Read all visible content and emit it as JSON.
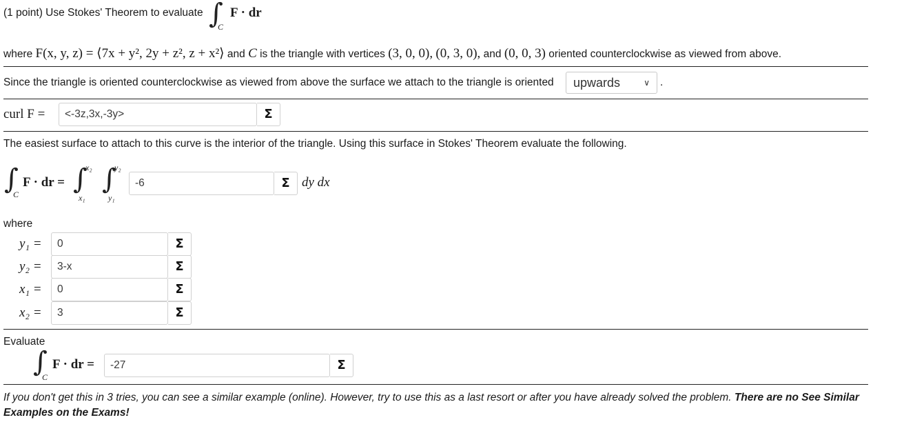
{
  "header": {
    "intro": "(1 point) Use Stokes' Theorem to evaluate",
    "integral_sub": "C",
    "integrand": "F · dr"
  },
  "problem": {
    "where_word": "where",
    "field_expr": "F(x, y, z) = ⟨7x + y², 2y + z², z + x²⟩",
    "and_c": "and",
    "c_symbol": "C",
    "triangle_text": "is the triangle with vertices",
    "v1": "(3, 0, 0),",
    "v2": "(0, 3, 0),",
    "and_word": "and",
    "v3": "(0, 0, 3)",
    "orient_text": "oriented counterclockwise as viewed from above."
  },
  "orientation": {
    "text": "Since the triangle is oriented counterclockwise as viewed from above the surface we attach to the triangle is oriented",
    "selected": "upwards",
    "period": "."
  },
  "curl": {
    "label": "curl F =",
    "value": "<-3z,3x,-3y>"
  },
  "surface_text": "The easiest surface to attach to this curve is the interior of the triangle. Using this surface in Stokes' Theorem evaluate the following.",
  "double_integral": {
    "lhs_sub": "C",
    "lhs_integrand": "F · dr =",
    "outer_upper": "x₂",
    "outer_lower": "x₁",
    "inner_upper": "y₂",
    "inner_lower": "y₁",
    "value": "-6",
    "differentials": "dy dx"
  },
  "where_label": "where",
  "bounds": [
    {
      "label": "y₁ =",
      "value": "0"
    },
    {
      "label": "y₂ =",
      "value": "3-x"
    },
    {
      "label": "x₁ =",
      "value": "0"
    },
    {
      "label": "x₂ =",
      "value": "3"
    }
  ],
  "evaluate": {
    "label": "Evaluate",
    "integral_sub": "C",
    "integrand": "F · dr =",
    "value": "-27"
  },
  "sigma_symbol": "Σ",
  "footer": {
    "text": "If you don't get this in 3 tries, you can see a similar example (online). However, try to use this as a last resort or after you have already solved the problem.",
    "bold_text": "There are no See Similar Examples on the Exams!"
  }
}
